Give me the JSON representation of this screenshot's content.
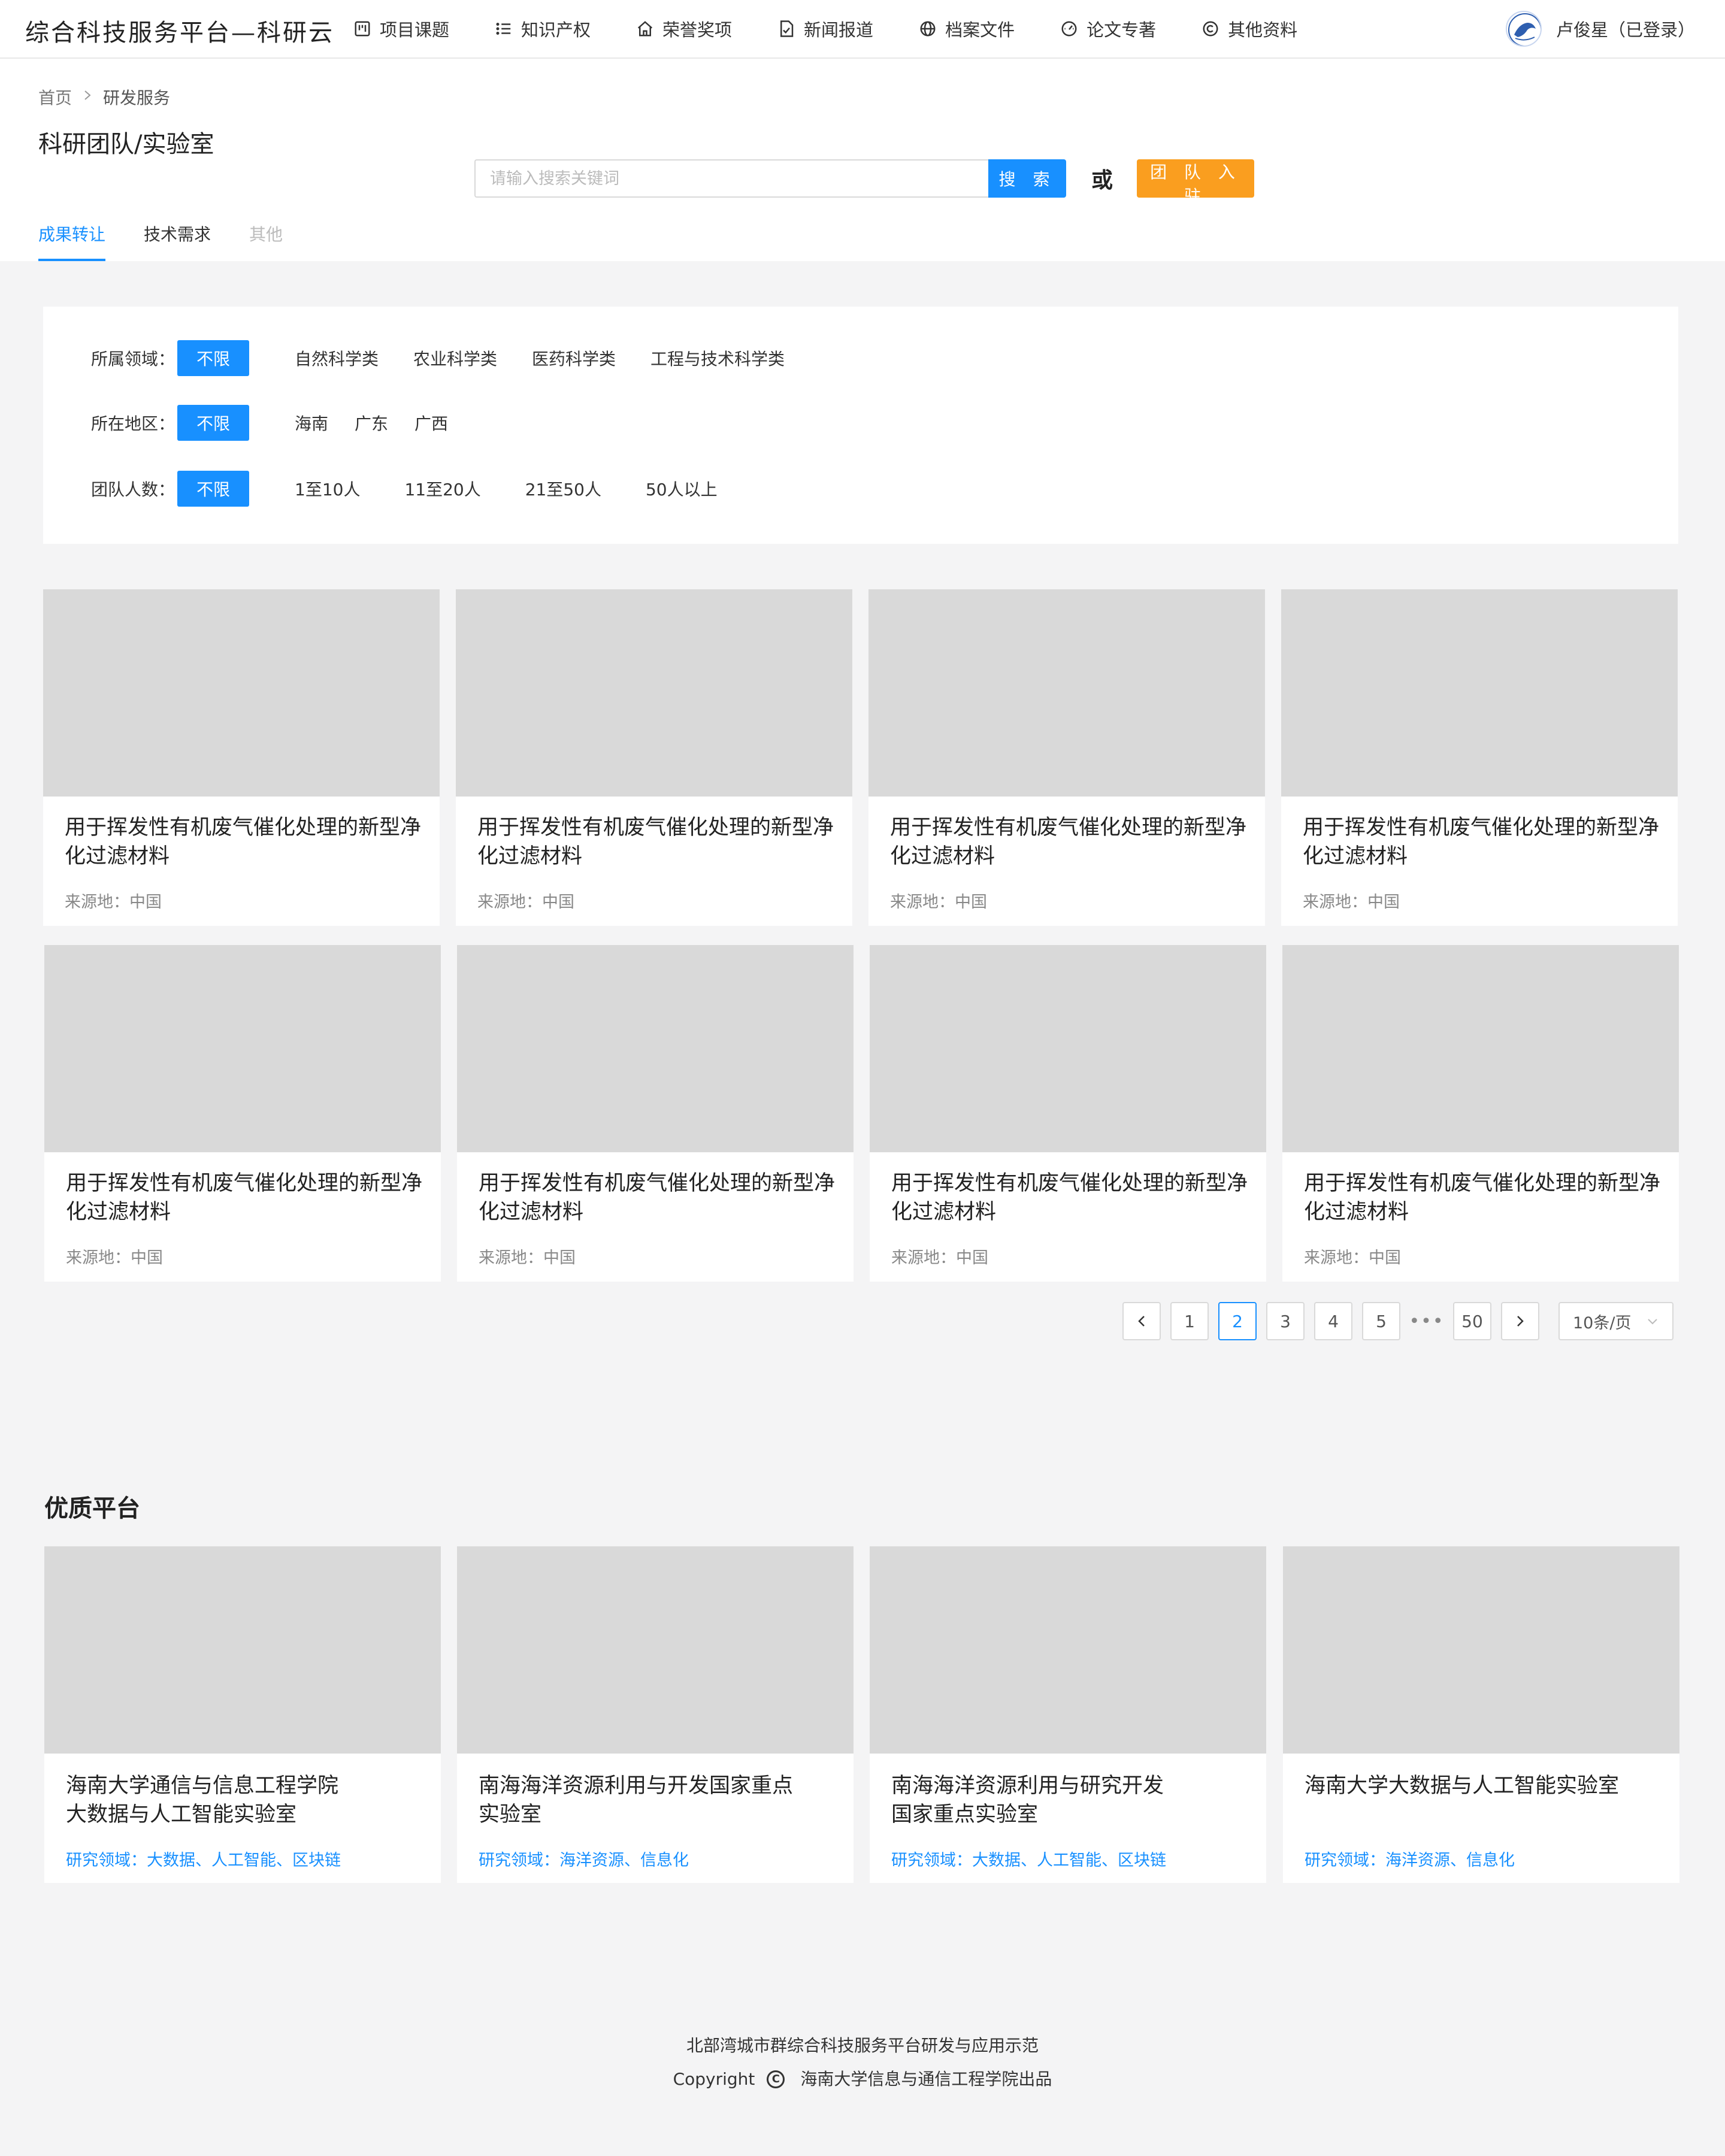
{
  "app": {
    "logo": "综合科技服务平台—科研云"
  },
  "nav": [
    {
      "label": "项目课题",
      "icon": "kanban-icon"
    },
    {
      "label": "知识产权",
      "icon": "list-icon"
    },
    {
      "label": "荣誉奖项",
      "icon": "home-icon"
    },
    {
      "label": "新闻报道",
      "icon": "document-check-icon"
    },
    {
      "label": "档案文件",
      "icon": "globe-icon"
    },
    {
      "label": "论文专著",
      "icon": "dashboard-icon"
    },
    {
      "label": "其他资料",
      "icon": "copyright-circle-icon"
    }
  ],
  "user": {
    "name": "卢俊星（已登录）"
  },
  "breadcrumb": {
    "home": "首页",
    "current": "研发服务"
  },
  "page": {
    "title": "科研团队/实验室"
  },
  "search": {
    "placeholder": "请输入搜索关键词",
    "button": "搜 索",
    "or": "或",
    "join": "团 队 入 驻"
  },
  "tabs": [
    "成果转让",
    "技术需求",
    "其他"
  ],
  "filters": {
    "field": {
      "label": "所属领域：",
      "all": "不限",
      "options": [
        "自然科学类",
        "农业科学类",
        "医药科学类",
        "工程与技术科学类"
      ]
    },
    "region": {
      "label": "所在地区：",
      "all": "不限",
      "options": [
        "海南",
        "广东",
        "广西"
      ]
    },
    "team_size": {
      "label": "团队人数：",
      "all": "不限",
      "options": [
        "1至10人",
        "11至20人",
        "21至50人",
        "50人以上"
      ]
    }
  },
  "results": [
    {
      "title": "用于挥发性有机废气催化处理的新型净化过滤材料",
      "source": "来源地：中国"
    },
    {
      "title": "用于挥发性有机废气催化处理的新型净化过滤材料",
      "source": "来源地：中国"
    },
    {
      "title": "用于挥发性有机废气催化处理的新型净化过滤材料",
      "source": "来源地：中国"
    },
    {
      "title": "用于挥发性有机废气催化处理的新型净化过滤材料",
      "source": "来源地：中国"
    },
    {
      "title": "用于挥发性有机废气催化处理的新型净化过滤材料",
      "source": "来源地：中国"
    },
    {
      "title": "用于挥发性有机废气催化处理的新型净化过滤材料",
      "source": "来源地：中国"
    },
    {
      "title": "用于挥发性有机废气催化处理的新型净化过滤材料",
      "source": "来源地：中国"
    },
    {
      "title": "用于挥发性有机废气催化处理的新型净化过滤材料",
      "source": "来源地：中国"
    }
  ],
  "pagination": {
    "pages": [
      "1",
      "2",
      "3",
      "4",
      "5"
    ],
    "current": "2",
    "dots": "•••",
    "last": "50",
    "page_size": "10条/页"
  },
  "platforms": {
    "title": "优质平台",
    "items": [
      {
        "title_line1": "海南大学通信与信息工程学院",
        "title_line2": "大数据与人工智能实验室",
        "fields": "研究领域：大数据、人工智能、区块链"
      },
      {
        "title_line1": "南海海洋资源利用与开发国家重点",
        "title_line2": "实验室",
        "fields": "研究领域：海洋资源、信息化"
      },
      {
        "title_line1": "南海海洋资源利用与研究开发",
        "title_line2": "国家重点实验室",
        "fields": "研究领域：大数据、人工智能、区块链"
      },
      {
        "title_line1": "海南大学大数据与人工智能实验室",
        "title_line2": "",
        "fields": "研究领域：海洋资源、信息化"
      }
    ]
  },
  "footer": {
    "line1": "北部湾城市群综合科技服务平台研发与应用示范",
    "copyright": "Copyright",
    "copyright_symbol": "C",
    "producer": "海南大学信息与通信工程学院出品"
  },
  "colors": {
    "primary": "#1890ff",
    "accent_orange": "#fa9e1f",
    "placeholder_gray": "#d9d9d9",
    "page_bg": "#f4f4f5"
  }
}
